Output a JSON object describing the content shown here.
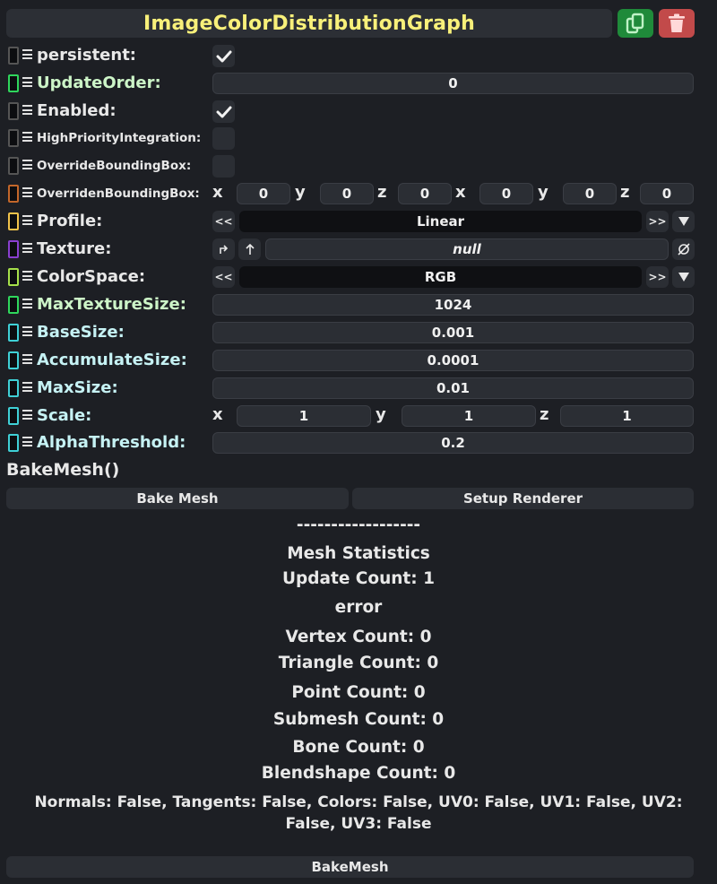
{
  "header": {
    "title": "ImageColorDistributionGraph",
    "duplicate_icon": "duplicate-icon",
    "delete_icon": "trash-icon"
  },
  "fields": {
    "persistent": {
      "label": "persistent:",
      "checked": true
    },
    "update_order": {
      "label": "UpdateOrder:",
      "value": "0"
    },
    "enabled": {
      "label": "Enabled:",
      "checked": true
    },
    "high_priority": {
      "label": "HighPriorityIntegration:",
      "checked": false
    },
    "override_bbox": {
      "label": "OverrideBoundingBox:",
      "checked": false
    },
    "overriden_bbox": {
      "label": "OverridenBoundingBox:",
      "axes": [
        "x",
        "y",
        "z",
        "x",
        "y",
        "z"
      ],
      "values": [
        "0",
        "0",
        "0",
        "0",
        "0",
        "0"
      ]
    },
    "profile": {
      "label": "Profile:",
      "value": "Linear",
      "prev": "<<",
      "next": ">>"
    },
    "texture": {
      "label": "Texture:",
      "value": "null"
    },
    "color_space": {
      "label": "ColorSpace:",
      "value": "RGB",
      "prev": "<<",
      "next": ">>"
    },
    "max_texture_size": {
      "label": "MaxTextureSize:",
      "value": "1024"
    },
    "base_size": {
      "label": "BaseSize:",
      "value": "0.001"
    },
    "accumulate_size": {
      "label": "AccumulateSize:",
      "value": "0.0001"
    },
    "max_size": {
      "label": "MaxSize:",
      "value": "0.01"
    },
    "scale": {
      "label": "Scale:",
      "axes": [
        "x",
        "y",
        "z"
      ],
      "values": [
        "1",
        "1",
        "1"
      ]
    },
    "alpha_threshold": {
      "label": "AlphaThreshold:",
      "value": "0.2"
    }
  },
  "method": {
    "name": "BakeMesh()",
    "bake_label": "Bake Mesh",
    "setup_label": "Setup Renderer"
  },
  "stats": {
    "separator": "------------------",
    "title": "Mesh Statistics",
    "update_count": "Update Count: 1",
    "error": "error",
    "vertex_count": "Vertex Count: 0",
    "triangle_count": "Triangle Count: 0",
    "point_count": "Point Count: 0",
    "submesh_count": "Submesh Count: 0",
    "bone_count": "Bone Count: 0",
    "blendshape_count": "Blendshape Count: 0",
    "attributes_line1": "Normals: False, Tangents: False, Colors: False, UV0: False, UV1: False, UV2:",
    "attributes_line2": "False, UV3: False"
  },
  "footer": {
    "button_label": "BakeMesh"
  },
  "colors": {
    "title": "#f8f07a",
    "swatch_update_order": "#2fd65c",
    "swatch_overriden": "#c2662a",
    "swatch_profile": "#f0c24a",
    "swatch_texture": "#8a3fd0",
    "swatch_colorspace": "#a6e04a",
    "swatch_float": "#3fd0d6"
  }
}
